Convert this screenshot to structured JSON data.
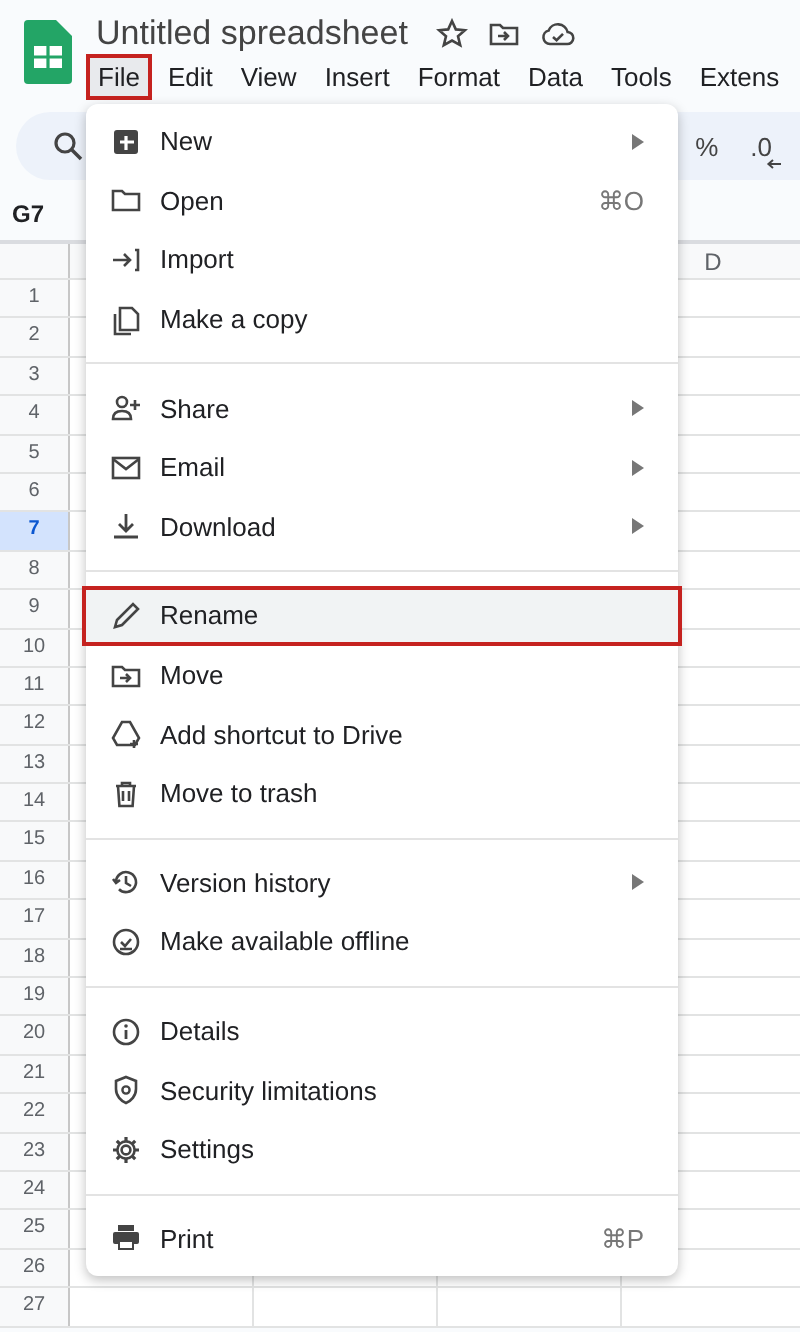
{
  "document": {
    "title": "Untitled spreadsheet"
  },
  "menu_bar": [
    {
      "label": "File",
      "highlighted": true
    },
    {
      "label": "Edit",
      "highlighted": false
    },
    {
      "label": "View",
      "highlighted": false
    },
    {
      "label": "Insert",
      "highlighted": false
    },
    {
      "label": "Format",
      "highlighted": false
    },
    {
      "label": "Data",
      "highlighted": false
    },
    {
      "label": "Tools",
      "highlighted": false
    },
    {
      "label": "Extens",
      "highlighted": false
    }
  ],
  "toolbar": {
    "items": [
      "%",
      ".0"
    ]
  },
  "name_box": "G7",
  "grid": {
    "columns": [
      "D"
    ],
    "rows": [
      {
        "number": "1",
        "selected": false
      },
      {
        "number": "2",
        "selected": false
      },
      {
        "number": "3",
        "selected": false
      },
      {
        "number": "4",
        "selected": false
      },
      {
        "number": "5",
        "selected": false
      },
      {
        "number": "6",
        "selected": false
      },
      {
        "number": "7",
        "selected": true
      },
      {
        "number": "8",
        "selected": false
      },
      {
        "number": "9",
        "selected": false
      },
      {
        "number": "10",
        "selected": false
      },
      {
        "number": "11",
        "selected": false
      },
      {
        "number": "12",
        "selected": false
      },
      {
        "number": "13",
        "selected": false
      },
      {
        "number": "14",
        "selected": false
      },
      {
        "number": "15",
        "selected": false
      },
      {
        "number": "16",
        "selected": false
      },
      {
        "number": "17",
        "selected": false
      },
      {
        "number": "18",
        "selected": false
      },
      {
        "number": "19",
        "selected": false
      },
      {
        "number": "20",
        "selected": false
      },
      {
        "number": "21",
        "selected": false
      },
      {
        "number": "22",
        "selected": false
      },
      {
        "number": "23",
        "selected": false
      },
      {
        "number": "24",
        "selected": false
      },
      {
        "number": "25",
        "selected": false
      },
      {
        "number": "26",
        "selected": false
      },
      {
        "number": "27",
        "selected": false
      }
    ]
  },
  "file_menu": {
    "sections": [
      [
        {
          "label": "New",
          "submenu": true,
          "highlighted": false
        },
        {
          "label": "Open",
          "shortcut": "⌘O",
          "submenu": false,
          "highlighted": false
        },
        {
          "label": "Import",
          "submenu": false,
          "highlighted": false
        },
        {
          "label": "Make a copy",
          "submenu": false,
          "highlighted": false
        }
      ],
      [
        {
          "label": "Share",
          "submenu": true,
          "highlighted": false
        },
        {
          "label": "Email",
          "submenu": true,
          "highlighted": false
        },
        {
          "label": "Download",
          "submenu": true,
          "highlighted": false
        }
      ],
      [
        {
          "label": "Rename",
          "submenu": false,
          "highlighted": true
        },
        {
          "label": "Move",
          "submenu": false,
          "highlighted": false
        },
        {
          "label": "Add shortcut to Drive",
          "submenu": false,
          "highlighted": false
        },
        {
          "label": "Move to trash",
          "submenu": false,
          "highlighted": false
        }
      ],
      [
        {
          "label": "Version history",
          "submenu": true,
          "highlighted": false
        },
        {
          "label": "Make available offline",
          "submenu": false,
          "highlighted": false
        }
      ],
      [
        {
          "label": "Details",
          "submenu": false,
          "highlighted": false
        },
        {
          "label": "Security limitations",
          "submenu": false,
          "highlighted": false
        },
        {
          "label": "Settings",
          "submenu": false,
          "highlighted": false
        }
      ],
      [
        {
          "label": "Print",
          "shortcut": "⌘P",
          "submenu": false,
          "highlighted": false
        }
      ]
    ]
  }
}
